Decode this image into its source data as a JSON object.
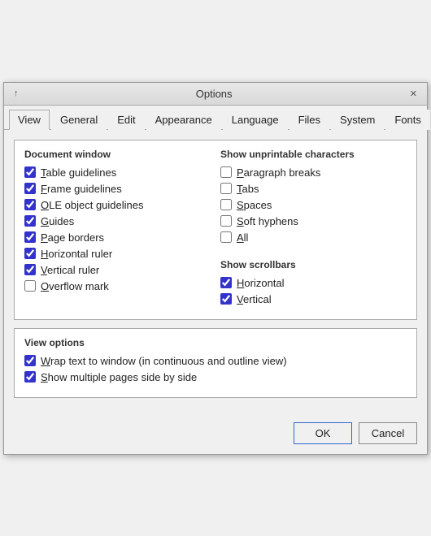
{
  "dialog": {
    "title": "Options"
  },
  "titlebar": {
    "up_btn": "↑",
    "x_btn": "✕"
  },
  "tabs": [
    {
      "label": "View",
      "active": true
    },
    {
      "label": "General",
      "active": false
    },
    {
      "label": "Edit",
      "active": false
    },
    {
      "label": "Appearance",
      "active": false
    },
    {
      "label": "Language",
      "active": false
    },
    {
      "label": "Files",
      "active": false
    },
    {
      "label": "System",
      "active": false
    },
    {
      "label": "Fonts",
      "active": false
    }
  ],
  "document_window": {
    "title": "Document window",
    "items": [
      {
        "label": "Table guidelines",
        "checked": true,
        "underline": "T"
      },
      {
        "label": "Frame guidelines",
        "checked": true,
        "underline": "F"
      },
      {
        "label": "OLE object guidelines",
        "checked": true,
        "underline": "O"
      },
      {
        "label": "Guides",
        "checked": true,
        "underline": "G"
      },
      {
        "label": "Page borders",
        "checked": true,
        "underline": "P"
      },
      {
        "label": "Horizontal ruler",
        "checked": true,
        "underline": "H"
      },
      {
        "label": "Vertical ruler",
        "checked": true,
        "underline": "V"
      },
      {
        "label": "Overflow mark",
        "checked": false,
        "underline": "O"
      }
    ]
  },
  "show_unprintable": {
    "title": "Show unprintable characters",
    "items": [
      {
        "label": "Paragraph breaks",
        "checked": false,
        "underline": "P"
      },
      {
        "label": "Tabs",
        "checked": false,
        "underline": "T"
      },
      {
        "label": "Spaces",
        "checked": false,
        "underline": "S"
      },
      {
        "label": "Soft hyphens",
        "checked": false,
        "underline": "S"
      },
      {
        "label": "All",
        "checked": false,
        "underline": "A"
      }
    ]
  },
  "show_scrollbars": {
    "title": "Show scrollbars",
    "items": [
      {
        "label": "Horizontal",
        "checked": true,
        "underline": "H"
      },
      {
        "label": "Vertical",
        "checked": true,
        "underline": "V"
      }
    ]
  },
  "view_options": {
    "title": "View options",
    "items": [
      {
        "label": "Wrap text to window (in continuous and outline view)",
        "checked": true,
        "underline": "W"
      },
      {
        "label": "Show multiple pages side by side",
        "checked": true,
        "underline": "S"
      }
    ]
  },
  "buttons": {
    "ok": "OK",
    "cancel": "Cancel"
  }
}
